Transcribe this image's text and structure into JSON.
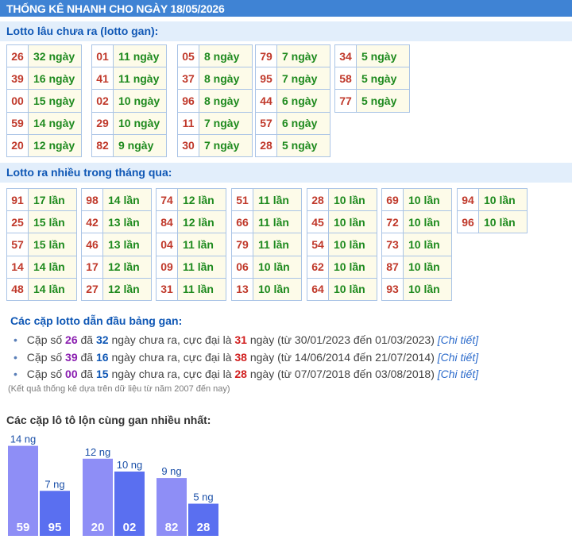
{
  "header": {
    "title": "THỐNG KÊ NHANH CHO NGÀY 18/05/2026"
  },
  "gan_section": {
    "title": "Lotto lâu chưa ra (lotto gan):",
    "columns": [
      [
        {
          "num": "26",
          "val": "32 ngày"
        },
        {
          "num": "39",
          "val": "16 ngày"
        },
        {
          "num": "00",
          "val": "15 ngày"
        },
        {
          "num": "59",
          "val": "14 ngày"
        },
        {
          "num": "20",
          "val": "12 ngày"
        }
      ],
      [
        {
          "num": "01",
          "val": "11 ngày"
        },
        {
          "num": "41",
          "val": "11 ngày"
        },
        {
          "num": "02",
          "val": "10 ngày"
        },
        {
          "num": "29",
          "val": "10 ngày"
        },
        {
          "num": "82",
          "val": "9 ngày"
        }
      ],
      [
        {
          "num": "05",
          "val": "8 ngày"
        },
        {
          "num": "37",
          "val": "8 ngày"
        },
        {
          "num": "96",
          "val": "8 ngày"
        },
        {
          "num": "11",
          "val": "7 ngày"
        },
        {
          "num": "30",
          "val": "7 ngày"
        }
      ],
      [
        {
          "num": "79",
          "val": "7 ngày"
        },
        {
          "num": "95",
          "val": "7 ngày"
        },
        {
          "num": "44",
          "val": "6 ngày"
        },
        {
          "num": "57",
          "val": "6 ngày"
        },
        {
          "num": "28",
          "val": "5 ngày"
        }
      ],
      [
        {
          "num": "34",
          "val": "5 ngày"
        },
        {
          "num": "58",
          "val": "5 ngày"
        },
        {
          "num": "77",
          "val": "5 ngày"
        }
      ]
    ]
  },
  "freq_section": {
    "title": "Lotto ra nhiều trong tháng qua:",
    "columns": [
      [
        {
          "num": "91",
          "val": "17 lần"
        },
        {
          "num": "25",
          "val": "15 lần"
        },
        {
          "num": "57",
          "val": "15 lần"
        },
        {
          "num": "14",
          "val": "14 lần"
        },
        {
          "num": "48",
          "val": "14 lần"
        }
      ],
      [
        {
          "num": "98",
          "val": "14 lần"
        },
        {
          "num": "42",
          "val": "13 lần"
        },
        {
          "num": "46",
          "val": "13 lần"
        },
        {
          "num": "17",
          "val": "12 lần"
        },
        {
          "num": "27",
          "val": "12 lần"
        }
      ],
      [
        {
          "num": "74",
          "val": "12 lần"
        },
        {
          "num": "84",
          "val": "12 lần"
        },
        {
          "num": "04",
          "val": "11 lần"
        },
        {
          "num": "09",
          "val": "11 lần"
        },
        {
          "num": "31",
          "val": "11 lần"
        }
      ],
      [
        {
          "num": "51",
          "val": "11 lần"
        },
        {
          "num": "66",
          "val": "11 lần"
        },
        {
          "num": "79",
          "val": "11 lần"
        },
        {
          "num": "06",
          "val": "10 lần"
        },
        {
          "num": "13",
          "val": "10 lần"
        }
      ],
      [
        {
          "num": "28",
          "val": "10 lần"
        },
        {
          "num": "45",
          "val": "10 lần"
        },
        {
          "num": "54",
          "val": "10 lần"
        },
        {
          "num": "62",
          "val": "10 lần"
        },
        {
          "num": "64",
          "val": "10 lần"
        }
      ],
      [
        {
          "num": "69",
          "val": "10 lần"
        },
        {
          "num": "72",
          "val": "10 lần"
        },
        {
          "num": "73",
          "val": "10 lần"
        },
        {
          "num": "87",
          "val": "10 lần"
        },
        {
          "num": "93",
          "val": "10 lần"
        }
      ],
      [
        {
          "num": "94",
          "val": "10 lần"
        },
        {
          "num": "96",
          "val": "10 lần"
        }
      ]
    ]
  },
  "pairs": {
    "title": "Các cặp lotto dẫn đầu bảng gan:",
    "items": [
      {
        "prefix": "Cặp số",
        "pair": "26",
        "mid1": "đã",
        "days": "32",
        "mid2": "ngày chưa ra, cực đại là",
        "max": "31",
        "range": "ngày (từ 30/01/2023 đến 01/03/2023)",
        "link": "[Chi tiết]"
      },
      {
        "prefix": "Cặp số",
        "pair": "39",
        "mid1": "đã",
        "days": "16",
        "mid2": "ngày chưa ra, cực đại là",
        "max": "38",
        "range": "ngày (từ 14/06/2014 đến 21/07/2014)",
        "link": "[Chi tiết]"
      },
      {
        "prefix": "Cặp số",
        "pair": "00",
        "mid1": "đã",
        "days": "15",
        "mid2": "ngày chưa ra, cực đại là",
        "max": "28",
        "range": "ngày (từ 07/07/2018 đến 03/08/2018)",
        "link": "[Chi tiết]"
      }
    ],
    "note": "(Kết quả thống kê dựa trên dữ liệu từ năm 2007 đến nay)"
  },
  "chart_title": "Các cặp lô tô lộn cùng gan nhiều nhất:",
  "chart_data": {
    "type": "bar",
    "unit_label": "ng",
    "groups": [
      {
        "bars": [
          {
            "label": "59",
            "value": 14
          },
          {
            "label": "95",
            "value": 7
          }
        ]
      },
      {
        "bars": [
          {
            "label": "20",
            "value": 12
          },
          {
            "label": "02",
            "value": 10
          }
        ]
      },
      {
        "bars": [
          {
            "label": "82",
            "value": 9
          },
          {
            "label": "28",
            "value": 5
          }
        ]
      }
    ],
    "colors": [
      "#8e8ef6",
      "#5a6ff0"
    ]
  }
}
